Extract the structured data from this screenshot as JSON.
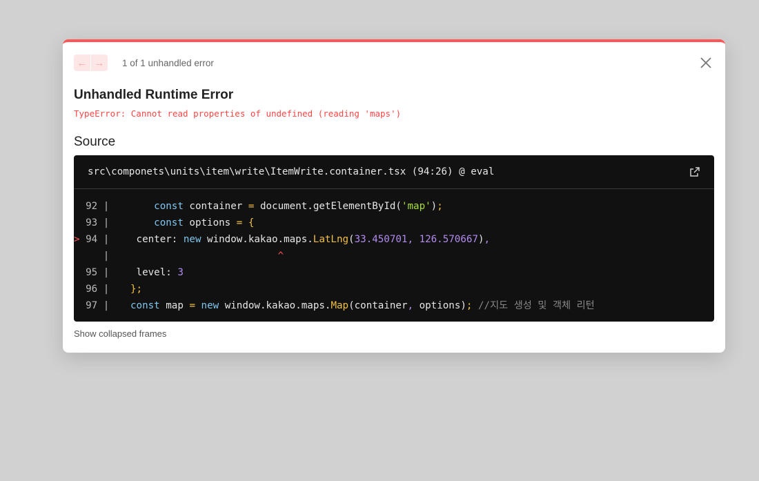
{
  "overlay": {
    "nav": {
      "prev_label": "←",
      "next_label": "→",
      "count_text": "1 of 1 unhandled error"
    },
    "title": "Unhandled Runtime Error",
    "error_message": "TypeError: Cannot read properties of undefined (reading 'maps')",
    "source_heading": "Source",
    "source": {
      "file_path": "src\\componets\\units\\item\\write\\ItemWrite.container.tsx (94:26) @ eval",
      "lines": [
        {
          "gutter": "  92 | ",
          "code": "    const container = document.getElementById('map');"
        },
        {
          "gutter": "  93 | ",
          "code": "    const options = {"
        },
        {
          "gutter": "> 94 | ",
          "code": " center: new window.kakao.maps.LatLng(33.450701, 126.570667),"
        },
        {
          "gutter": "     | ",
          "code": "                         ^"
        },
        {
          "gutter": "  95 | ",
          "code": " level: 3"
        },
        {
          "gutter": "  96 | ",
          "code": "};"
        },
        {
          "gutter": "  97 | ",
          "code": "const map = new window.kakao.maps.Map(container, options); //지도 생성 및 객체 리턴"
        }
      ]
    },
    "show_collapsed_label": "Show collapsed frames",
    "colors": {
      "accent": "#ff5555",
      "code_bg": "#111111",
      "keyword": "#7ec8f0",
      "string": "#a6e22e",
      "number": "#b38cf0",
      "function": "#f0c040",
      "comment": "#888888"
    }
  }
}
